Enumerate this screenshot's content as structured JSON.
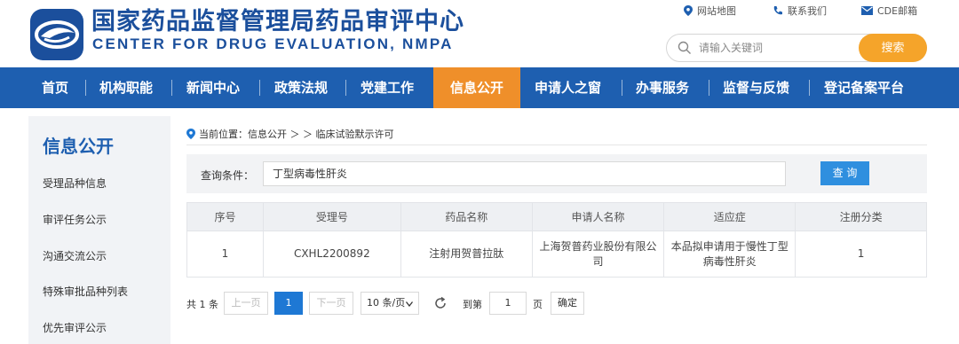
{
  "header": {
    "title_cn": "国家药品监督管理局药品审评中心",
    "title_en": "CENTER FOR DRUG EVALUATION, NMPA",
    "top_links": [
      {
        "label": "网站地图",
        "icon": "location-pin-icon"
      },
      {
        "label": "联系我们",
        "icon": "phone-icon"
      },
      {
        "label": "CDE邮箱",
        "icon": "mail-icon"
      }
    ],
    "search_placeholder": "请输入关键词",
    "search_button": "搜索"
  },
  "nav": {
    "items": [
      "首页",
      "机构职能",
      "新闻中心",
      "政策法规",
      "党建工作",
      "信息公开",
      "申请人之窗",
      "办事服务",
      "监督与反馈",
      "登记备案平台"
    ],
    "active": "信息公开"
  },
  "sidebar": {
    "title": "信息公开",
    "items": [
      "受理品种信息",
      "审评任务公示",
      "沟通交流公示",
      "特殊审批品种列表",
      "优先审评公示"
    ]
  },
  "breadcrumb": {
    "prefix": "当前位置：",
    "path": "信息公开 ＞ ＞ 临床试验默示许可"
  },
  "query": {
    "label": "查询条件：",
    "value": "丁型病毒性肝炎",
    "button": "查 询"
  },
  "table": {
    "columns": [
      "序号",
      "受理号",
      "药品名称",
      "申请人名称",
      "适应症",
      "注册分类"
    ],
    "rows": [
      [
        "1",
        "CXHL2200892",
        "注射用贺普拉肽",
        "上海贺普药业股份有限公司",
        "本品拟申请用于慢性丁型病毒性肝炎",
        "1"
      ]
    ]
  },
  "pager": {
    "total": "共 1 条",
    "prev": "上一页",
    "current_page": "1",
    "next": "下一页",
    "page_size": "10 条/页",
    "goto_label": "到第",
    "goto_value": "1",
    "page_unit": "页",
    "confirm": "确定"
  },
  "colors": {
    "brand_blue": "#1e5fb0",
    "nav_active": "#ef8f2a",
    "search_button": "#f5a42a",
    "query_button": "#2f8fdf"
  }
}
